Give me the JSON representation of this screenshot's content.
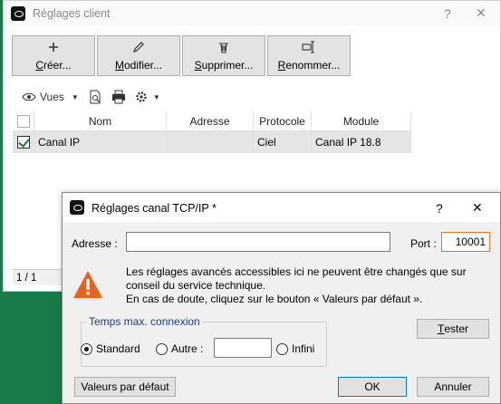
{
  "background_window": {
    "title": "Réglages client",
    "help_glyph": "?",
    "close_glyph": "✕",
    "toolbar": [
      {
        "icon": "plus-icon",
        "mnemonic": "C",
        "rest": "réer..."
      },
      {
        "icon": "pencil-icon",
        "mnemonic": "M",
        "rest": "odifier..."
      },
      {
        "icon": "trash-icon",
        "mnemonic": "S",
        "rest": "upprimer..."
      },
      {
        "icon": "rename-icon",
        "mnemonic": "R",
        "rest": "enommer..."
      }
    ],
    "list_toolbar": {
      "views_label": "Vues"
    },
    "table": {
      "columns": [
        "Nom",
        "Adresse",
        "Protocole",
        "Module"
      ],
      "rows": [
        {
          "checked": true,
          "nom": "Canal IP",
          "adresse": "",
          "protocole": "Ciel",
          "module": "Canal IP 18.8"
        }
      ]
    },
    "pager": "1 / 1"
  },
  "dialog": {
    "title": "Réglages canal TCP/IP *",
    "help_glyph": "?",
    "close_glyph": "✕",
    "address_label": "Adresse :",
    "address_value": "",
    "port_label": "Port :",
    "port_value": "10001",
    "warning_line1": "Les réglages avancés accessibles ici ne peuvent être changés que sur",
    "warning_line2": "conseil du service technique.",
    "warning_line3": "En cas de doute, cliquez sur le bouton « Valeurs par défaut ».",
    "group_title": "Temps max. connexion",
    "radio_standard": "Standard",
    "radio_autre": "Autre :",
    "autre_value": "",
    "radio_infini": "Infini",
    "selected_radio": "standard",
    "test_button": "Tester",
    "defaults_button": "Valeurs par défaut",
    "ok_button": "OK",
    "cancel_button": "Annuler"
  },
  "colors": {
    "warning_orange": "#e8641e",
    "group_title_blue": "#1a3c8a",
    "brand_green": "#1b7a4a"
  }
}
